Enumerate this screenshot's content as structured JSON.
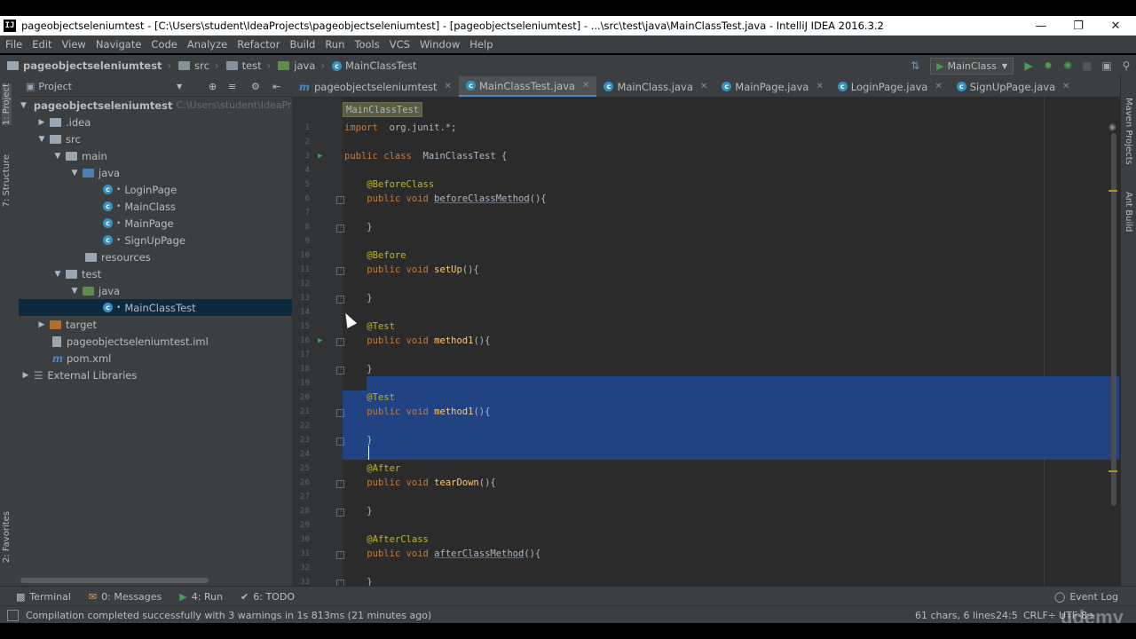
{
  "window": {
    "title": "pageobjectseleniumtest - [C:\\Users\\student\\IdeaProjects\\pageobjectseleniumtest] - [pageobjectseleniumtest] - ...\\src\\test\\java\\MainClassTest.java - IntelliJ IDEA 2016.3.2",
    "app_icon": "IJ"
  },
  "menu": [
    "File",
    "Edit",
    "View",
    "Navigate",
    "Code",
    "Analyze",
    "Refactor",
    "Build",
    "Run",
    "Tools",
    "VCS",
    "Window",
    "Help"
  ],
  "breadcrumb": [
    "pageobjectseleniumtest",
    "src",
    "test",
    "java",
    "MainClassTest"
  ],
  "run_config": "MainClass",
  "left_tabs": [
    "1: Project",
    "7: Structure",
    "2: Favorites"
  ],
  "right_tabs": [
    "Maven Projects",
    "Ant Build"
  ],
  "project_panel": {
    "title": "Project",
    "root_path": "C:\\Users\\student\\IdeaProjec",
    "tree": [
      {
        "label": "pageobjectseleniumtest"
      },
      {
        "label": ".idea"
      },
      {
        "label": "src"
      },
      {
        "label": "main"
      },
      {
        "label": "java"
      },
      {
        "label": "LoginPage"
      },
      {
        "label": "MainClass"
      },
      {
        "label": "MainPage"
      },
      {
        "label": "SignUpPage"
      },
      {
        "label": "resources"
      },
      {
        "label": "test"
      },
      {
        "label": "java"
      },
      {
        "label": "MainClassTest"
      },
      {
        "label": "target"
      },
      {
        "label": "pageobjectseleniumtest.iml"
      },
      {
        "label": "pom.xml"
      },
      {
        "label": "External Libraries"
      }
    ]
  },
  "editor_tabs": [
    {
      "label": "pageobjectseleniumtest"
    },
    {
      "label": "MainClassTest.java"
    },
    {
      "label": "MainClass.java"
    },
    {
      "label": "MainPage.java"
    },
    {
      "label": "LoginPage.java"
    },
    {
      "label": "SignUpPage.java"
    }
  ],
  "editor": {
    "class_crumb": "MainClassTest",
    "lines": [
      {
        "num": "1",
        "a": "import",
        "b": " org.junit.*;"
      },
      {
        "num": "2",
        "a": "",
        "b": ""
      },
      {
        "num": "3",
        "a": "public class",
        "b": " MainClassTest {"
      },
      {
        "num": "4",
        "a": "",
        "b": ""
      },
      {
        "num": "5",
        "ann": "@BeforeClass"
      },
      {
        "num": "6",
        "a": "public void",
        "u": "beforeClassMethod",
        "b": "(){"
      },
      {
        "num": "7",
        "a": "",
        "b": ""
      },
      {
        "num": "8",
        "a": "",
        "b": "}"
      },
      {
        "num": "9",
        "a": "",
        "b": ""
      },
      {
        "num": "10",
        "ann": "@Before"
      },
      {
        "num": "11",
        "a": "public void",
        "f": "setUp",
        "b": "(){"
      },
      {
        "num": "12",
        "a": "",
        "b": ""
      },
      {
        "num": "13",
        "a": "",
        "b": "}"
      },
      {
        "num": "14",
        "a": "",
        "b": ""
      },
      {
        "num": "15",
        "ann": "@Test"
      },
      {
        "num": "16",
        "a": "public void",
        "f": "method1",
        "b": "(){"
      },
      {
        "num": "17",
        "a": "",
        "b": ""
      },
      {
        "num": "18",
        "a": "",
        "b": "}"
      },
      {
        "num": "19",
        "a": "",
        "b": ""
      },
      {
        "num": "20",
        "ann": "@Test"
      },
      {
        "num": "21",
        "a": "public void",
        "f": "method1",
        "b": "(){"
      },
      {
        "num": "22",
        "a": "",
        "b": ""
      },
      {
        "num": "23",
        "a": "",
        "b": "}"
      },
      {
        "num": "24",
        "a": "",
        "b": ""
      },
      {
        "num": "25",
        "ann": "@After"
      },
      {
        "num": "26",
        "a": "public void",
        "f": "tearDown",
        "b": "(){"
      },
      {
        "num": "27",
        "a": "",
        "b": ""
      },
      {
        "num": "28",
        "a": "",
        "b": "}"
      },
      {
        "num": "29",
        "a": "",
        "b": ""
      },
      {
        "num": "30",
        "ann": "@AfterClass"
      },
      {
        "num": "31",
        "a": "public void",
        "u": "afterClassMethod",
        "b": "(){"
      },
      {
        "num": "32",
        "a": "",
        "b": ""
      },
      {
        "num": "33",
        "a": "",
        "b": "}"
      }
    ]
  },
  "bottom_tools": [
    "Terminal",
    "0: Messages",
    "4: Run",
    "6: TODO"
  ],
  "event_log": "Event Log",
  "status": {
    "message": "Compilation completed successfully with 3 warnings in 1s 813ms (21 minutes ago)",
    "selection": "61 chars, 6 lines",
    "position": "24:5",
    "line_sep": "CRLF÷",
    "encoding": "UTF-8÷"
  },
  "watermark": "udemy"
}
